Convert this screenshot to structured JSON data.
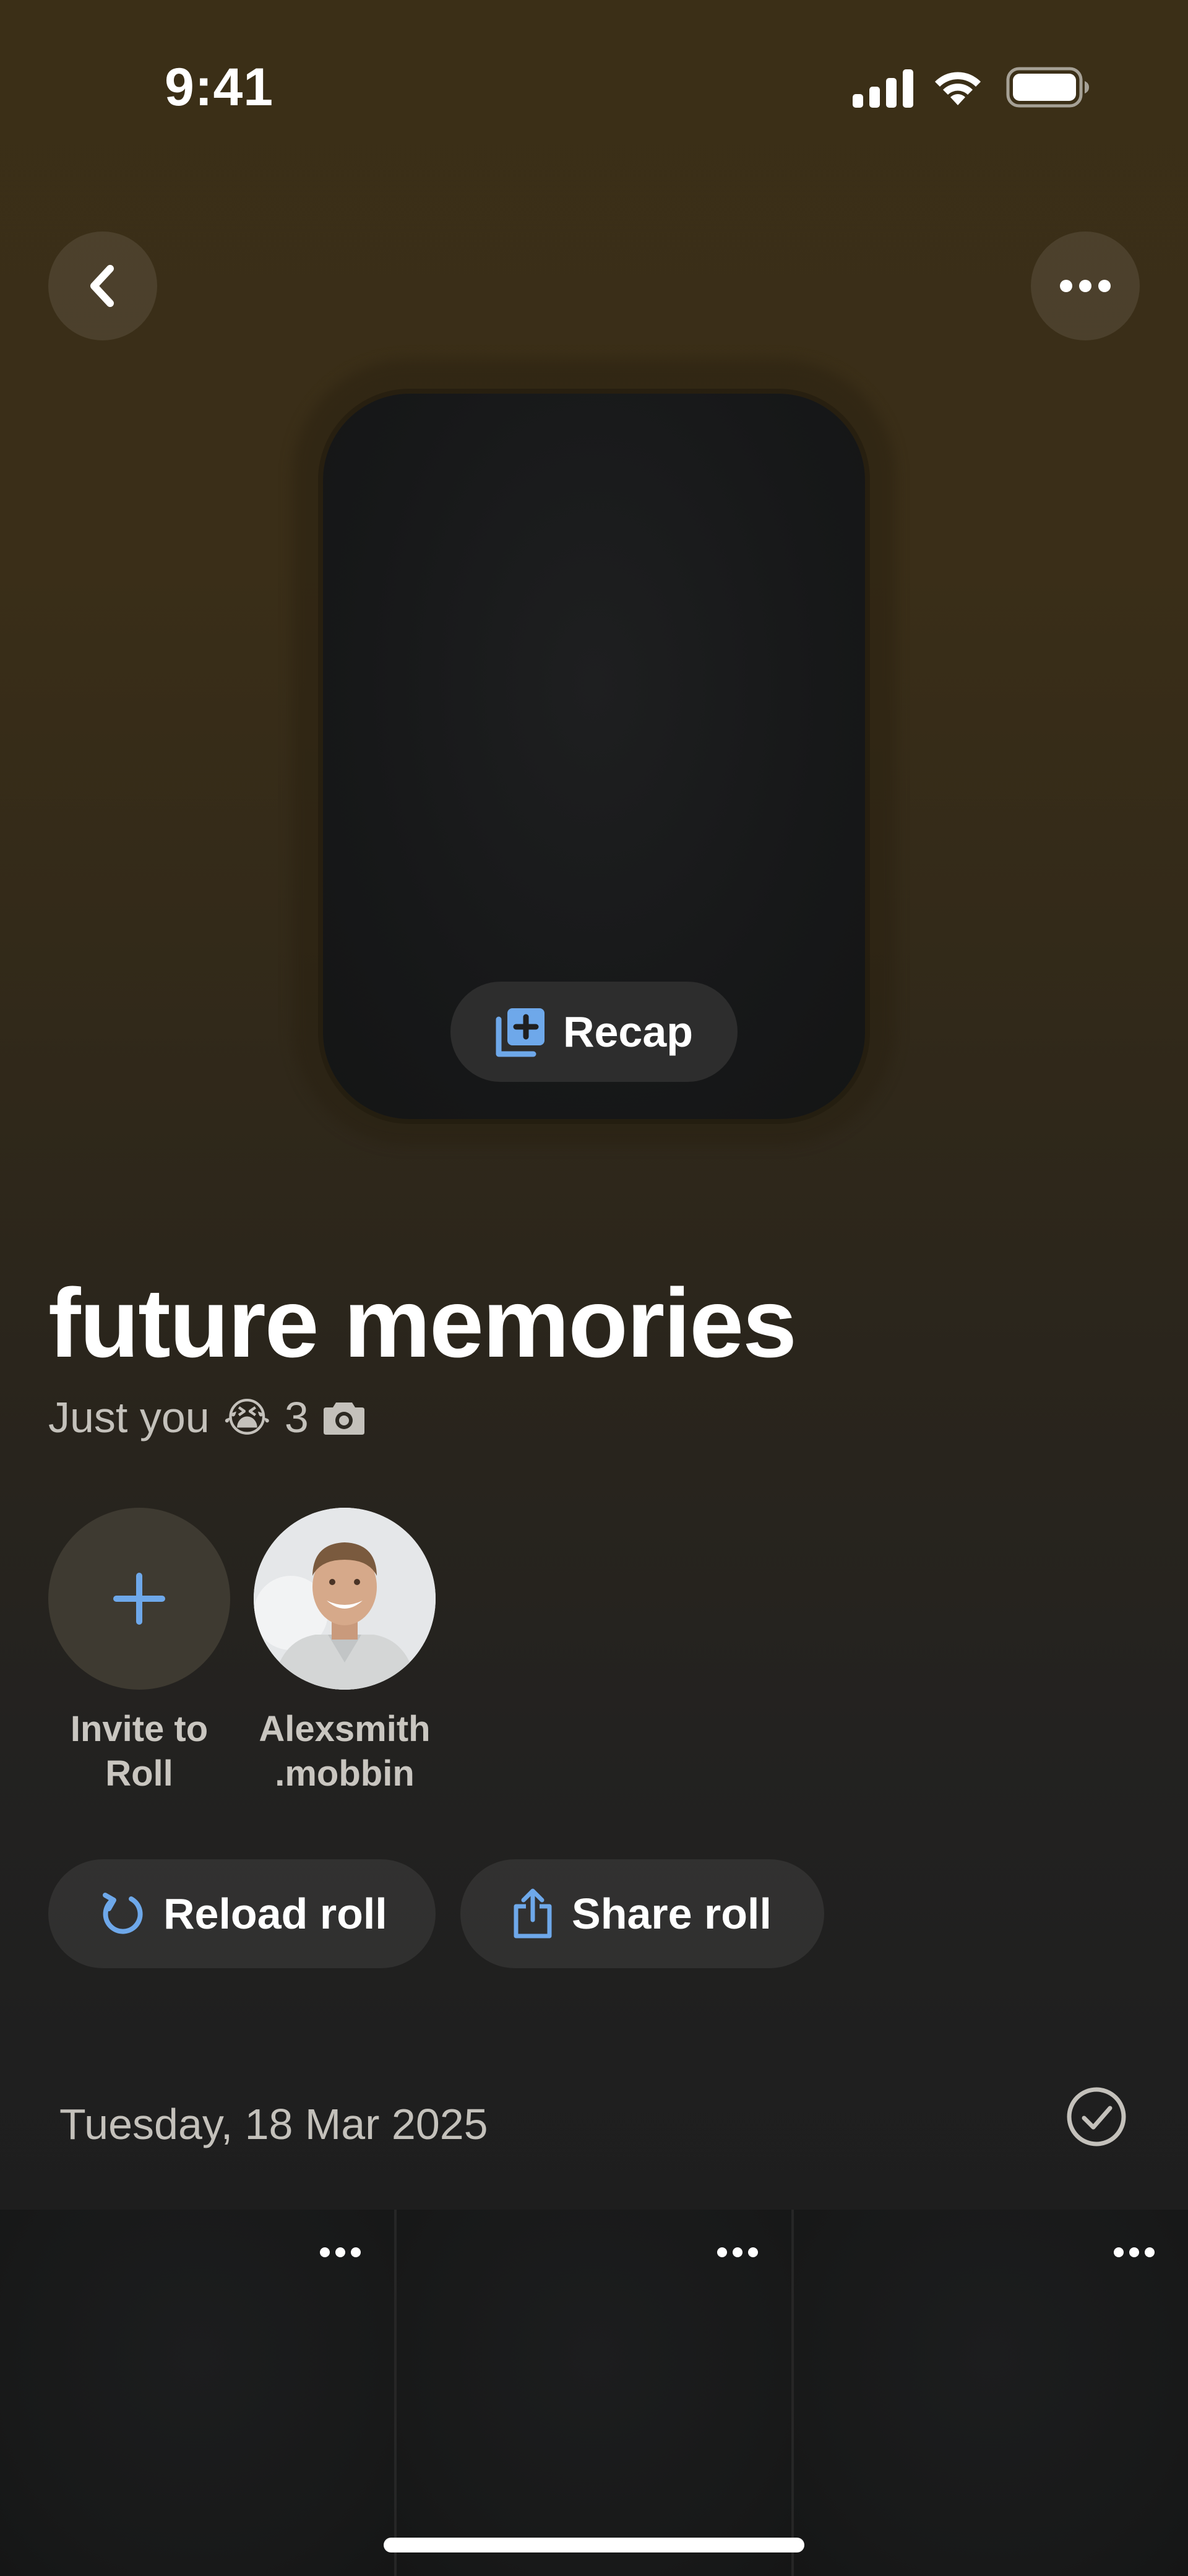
{
  "status_bar": {
    "time": "9:41"
  },
  "nav": {
    "back_icon": "chevron-left-icon",
    "more_icon": "ellipsis-icon"
  },
  "cover": {
    "recap_label": "Recap",
    "recap_icon": "add-collection-icon"
  },
  "roll": {
    "title": "future memories",
    "subtitle_text": "Just you",
    "subtitle_emoji": "😭",
    "photo_count": "3",
    "photo_count_icon": "camera-icon"
  },
  "people": [
    {
      "name": "Invite to\nRoll",
      "icon": "plus-icon"
    },
    {
      "name": "Alexsmith\n.mobbin",
      "icon": "avatar"
    }
  ],
  "actions": {
    "reload_label": "Reload roll",
    "share_label": "Share roll"
  },
  "section": {
    "date": "Tuesday, 18 Mar 2025"
  },
  "colors": {
    "accent": "#6ea8ea",
    "background_top": "#3b2f17",
    "background_bottom": "#1d1d1d"
  }
}
